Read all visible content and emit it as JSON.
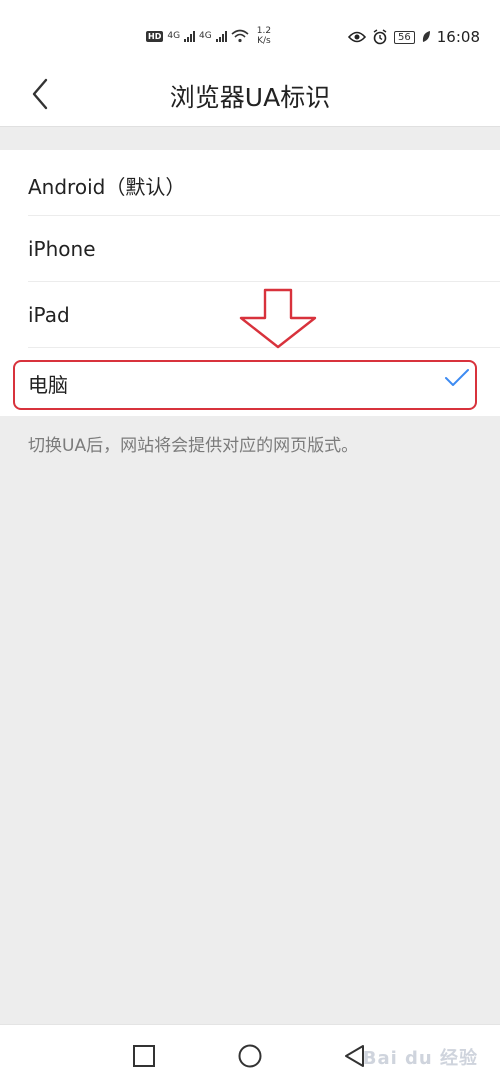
{
  "status_bar": {
    "hd": "HD",
    "sim1": "4G",
    "sim2": "4G",
    "speed_value": "1.2",
    "speed_unit": "K/s",
    "battery": "56",
    "time": "16:08"
  },
  "header": {
    "title": "浏览器UA标识"
  },
  "options": [
    {
      "label": "Android（默认）",
      "selected": false
    },
    {
      "label": "iPhone",
      "selected": false
    },
    {
      "label": "iPad",
      "selected": false
    },
    {
      "label": "电脑",
      "selected": true
    }
  ],
  "hint": "切换UA后，网站将会提供对应的网页版式。",
  "watermark": "Bai du 经验",
  "colors": {
    "accent": "#3d8bf2",
    "annotation": "#d8323c"
  }
}
